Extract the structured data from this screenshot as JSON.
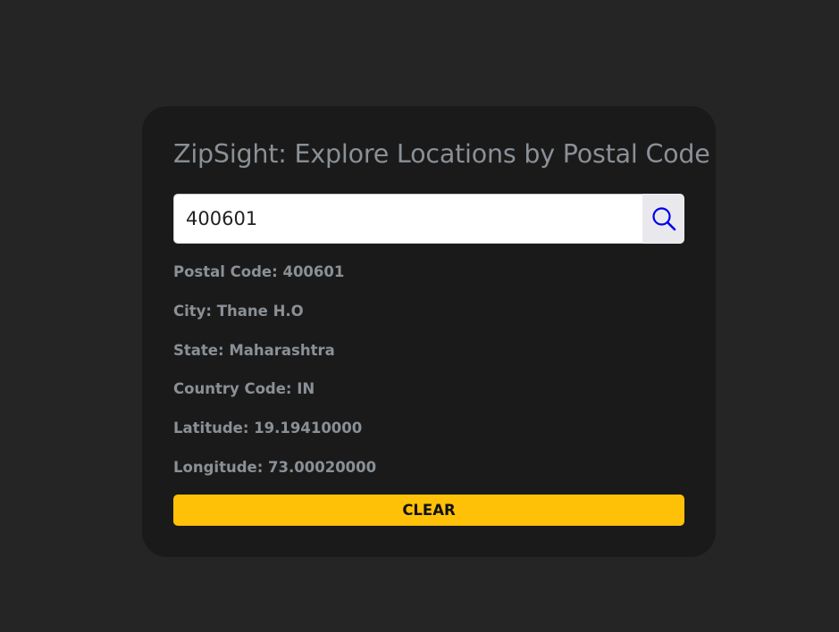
{
  "app": {
    "title": "ZipSight: Explore Locations by Postal Code"
  },
  "search": {
    "value": "400601",
    "button_icon": "search-icon"
  },
  "result": {
    "postal_code": "Postal Code: 400601",
    "city": "City: Thane H.O",
    "state": "State: Maharashtra",
    "country_code": "Country Code: IN",
    "latitude": "Latitude: 19.19410000",
    "longitude": "Longitude: 73.00020000"
  },
  "actions": {
    "clear_label": "CLEAR"
  },
  "colors": {
    "page_background": "#252525",
    "card_background": "#1a1a1a",
    "text": "#8a9096",
    "clear_button": "#ffc107",
    "search_icon": "#0000ee"
  }
}
